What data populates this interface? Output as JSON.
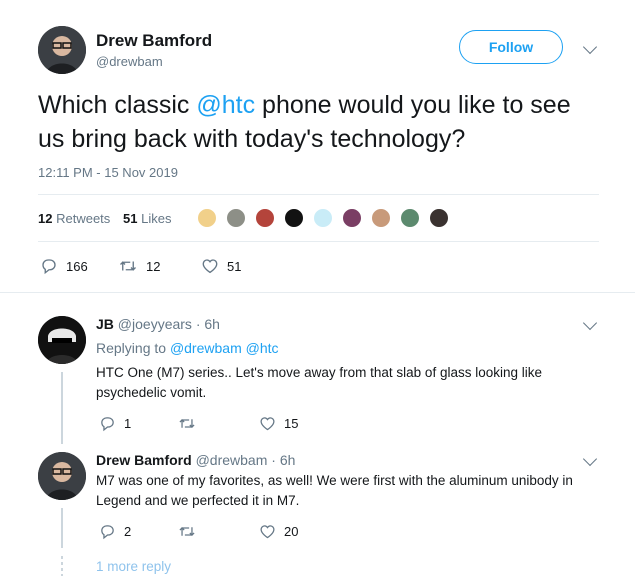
{
  "tweet": {
    "author_name": "Drew Bamford",
    "author_handle": "@drewbam",
    "follow_label": "Follow",
    "text_before": "Which classic ",
    "text_mention": "@htc",
    "text_after": " phone would you like to see us bring back with today's technology?",
    "timestamp": "12:11 PM - 15 Nov 2019",
    "retweets_count": "12",
    "retweets_label": "Retweets",
    "likes_count": "51",
    "likes_label": "Likes",
    "actions": {
      "replies": "166",
      "retweets": "12",
      "likes": "51"
    }
  },
  "replies": [
    {
      "author_name": "JB",
      "author_handle": "@joeyyears",
      "time": "· 6h",
      "replying_label": "Replying to",
      "replying_to": "@drewbam @htc",
      "text": "HTC One (M7) series.. Let's move away from that slab of glass looking like psychedelic vomit.",
      "actions": {
        "replies": "1",
        "retweets": "",
        "likes": "15"
      }
    },
    {
      "author_name": "Drew Bamford",
      "author_handle": "@drewbam",
      "time": "· 6h",
      "text": "M7 was one of my favorites, as well! We were first with the aluminum unibody in Legend and we perfected it in M7.",
      "actions": {
        "replies": "2",
        "retweets": "",
        "likes": "20"
      }
    }
  ],
  "more_replies_label": "1 more reply",
  "colors": {
    "accent": "#1da1f2",
    "muted": "#657786",
    "divider": "#e6ecf0"
  },
  "icons": [
    "reply-icon",
    "retweet-icon",
    "like-icon",
    "chevron-down-icon"
  ]
}
